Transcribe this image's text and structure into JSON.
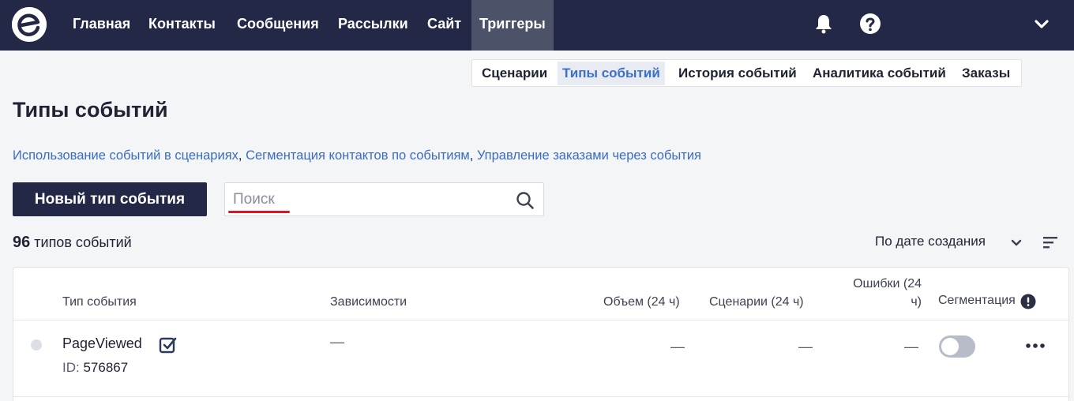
{
  "nav": {
    "logo_icon": "brand-logo-icon",
    "items": [
      {
        "label": "Главная"
      },
      {
        "label": "Контакты"
      },
      {
        "label": "Сообщения"
      },
      {
        "label": "Рассылки"
      },
      {
        "label": "Сайт"
      },
      {
        "label": "Триггеры",
        "active": true
      }
    ],
    "icons": [
      "bell-icon",
      "help-icon",
      "chevron-down-icon"
    ]
  },
  "subnav": {
    "items": [
      {
        "label": "Сценарии"
      },
      {
        "label": "Типы событий",
        "active": true
      },
      {
        "label": "История событий"
      },
      {
        "label": "Аналитика событий"
      },
      {
        "label": "Заказы"
      }
    ]
  },
  "page": {
    "title": "Типы событий",
    "links": [
      "Использование событий в сценариях",
      "Сегментация контактов по событиям",
      "Управление заказами через события"
    ],
    "link_separator": ", "
  },
  "toolbar": {
    "new_button": "Новый тип события",
    "search_placeholder": "Поиск",
    "search_value": ""
  },
  "summary": {
    "count": "96",
    "count_label": "типов событий",
    "sort_label": "По дате создания"
  },
  "table": {
    "columns": {
      "event_type": "Тип события",
      "dependencies": "Зависимости",
      "volume": "Объем (24 ч)",
      "scenarios": "Сценарии (24 ч)",
      "errors_line1": "Ошибки (24",
      "errors_line2": "ч)",
      "segmentation": "Сегментация"
    },
    "rows": [
      {
        "name": "PageViewed",
        "id_label": "ID:",
        "id": "576867",
        "dependencies": "—",
        "volume": "—",
        "scenarios": "—",
        "errors": "—",
        "segmentation_enabled": false
      }
    ]
  },
  "colors": {
    "nav_bg": "#222845",
    "nav_active": "#4c5268",
    "link": "#3a6cc4",
    "accent_underline": "#e0141e",
    "subnav_active_text": "#3c70c8"
  }
}
